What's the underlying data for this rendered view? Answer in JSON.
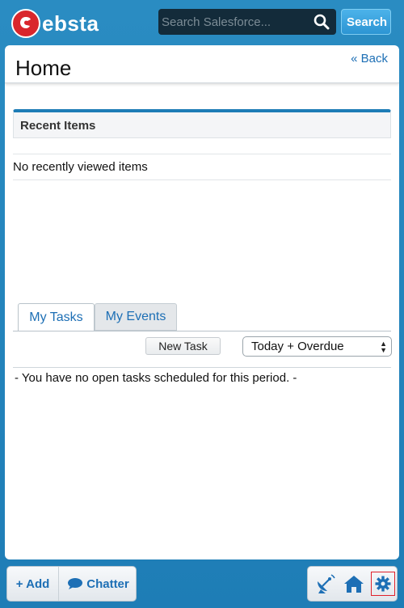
{
  "header": {
    "logo_text": "ebsta",
    "search_placeholder": "Search Salesforce...",
    "search_button": "Search"
  },
  "page": {
    "title": "Home",
    "back_link": "« Back"
  },
  "recent": {
    "title": "Recent Items",
    "empty_message": "No recently viewed items"
  },
  "tasks": {
    "tabs": [
      "My Tasks",
      "My Events"
    ],
    "active_tab": "My Tasks",
    "new_task_button": "New Task",
    "period_selected": "Today + Overdue",
    "empty_message": "- You have no open tasks scheduled for this period. -"
  },
  "footer": {
    "add_label": "+ Add",
    "chatter_label": "Chatter",
    "icons": [
      "satellite-dish-icon",
      "home-icon",
      "gear-icon"
    ]
  },
  "colors": {
    "header_blue": "#1e7db6",
    "accent_blue": "#1d6fb5",
    "logo_red": "#d9262c",
    "highlight_red": "#e0212b"
  }
}
